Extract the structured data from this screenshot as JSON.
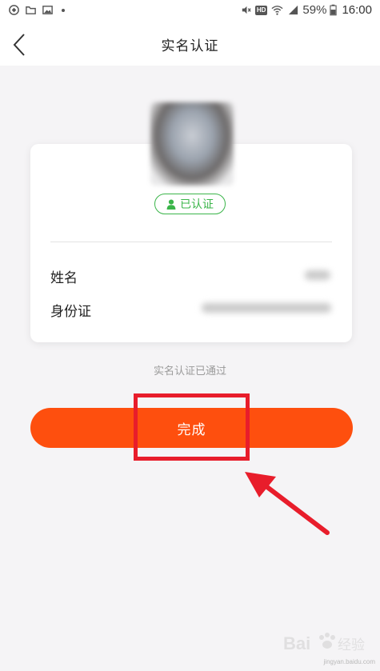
{
  "status_bar": {
    "left_icons": [
      "sync-icon",
      "folder-icon",
      "image-icon",
      "dot-icon"
    ],
    "right_icons": [
      "mute-icon",
      "hd-icon",
      "wifi-icon",
      "signal-icon",
      "battery-icon"
    ],
    "hd_label": "HD",
    "signal_type": "4G",
    "battery": "59%",
    "time": "16:00"
  },
  "nav": {
    "back_icon": "chevron-left-icon",
    "title": "实名认证"
  },
  "profile": {
    "verified_icon": "user-icon",
    "verified_label": "已认证",
    "verified_color": "#3bb54a",
    "fields": [
      {
        "label": "姓名"
      },
      {
        "label": "身份证"
      }
    ]
  },
  "status_text": "实名认证已通过",
  "done_button": {
    "label": "完成",
    "color": "#fe4f0e"
  },
  "annotation": {
    "color": "#e81d2b",
    "shapes": [
      "highlight-box",
      "arrow"
    ]
  },
  "watermark": {
    "logo_text": "Bai",
    "logo_cn": "经验",
    "url": "jingyan.baidu.com"
  }
}
